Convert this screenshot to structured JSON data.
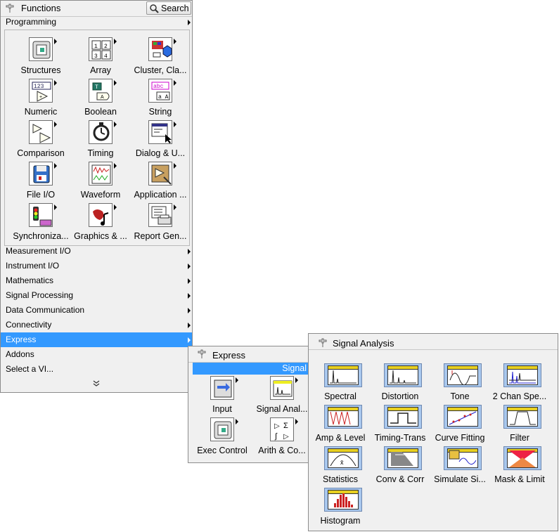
{
  "functions": {
    "title": "Functions",
    "search_label": "Search",
    "programming_label": "Programming",
    "grid": [
      {
        "label": "Structures",
        "icon": "structures-icon"
      },
      {
        "label": "Array",
        "icon": "array-icon"
      },
      {
        "label": "Cluster, Cla...",
        "icon": "cluster-icon"
      },
      {
        "label": "Numeric",
        "icon": "numeric-icon"
      },
      {
        "label": "Boolean",
        "icon": "boolean-icon"
      },
      {
        "label": "String",
        "icon": "string-icon"
      },
      {
        "label": "Comparison",
        "icon": "comparison-icon"
      },
      {
        "label": "Timing",
        "icon": "timing-icon"
      },
      {
        "label": "Dialog & U...",
        "icon": "dialog-icon"
      },
      {
        "label": "File I/O",
        "icon": "file-io-icon"
      },
      {
        "label": "Waveform",
        "icon": "waveform-icon"
      },
      {
        "label": "Application ...",
        "icon": "application-icon"
      },
      {
        "label": "Synchroniza...",
        "icon": "synchronization-icon"
      },
      {
        "label": "Graphics & ...",
        "icon": "graphics-icon"
      },
      {
        "label": "Report Gen...",
        "icon": "report-icon"
      }
    ],
    "categories": [
      {
        "label": "Measurement I/O"
      },
      {
        "label": "Instrument I/O"
      },
      {
        "label": "Mathematics"
      },
      {
        "label": "Signal Processing"
      },
      {
        "label": "Data Communication"
      },
      {
        "label": "Connectivity"
      },
      {
        "label": "Express",
        "selected": true
      },
      {
        "label": "Addons"
      }
    ],
    "select_vi_label": "Select a VI...",
    "more_icon": "double-chevron-down-icon"
  },
  "express": {
    "title": "Express",
    "highlight_label": "Signal",
    "items": [
      {
        "label": "Input",
        "icon": "input-icon"
      },
      {
        "label": "Signal Anal...",
        "icon": "signal-analysis-icon"
      },
      {
        "label": "Exec Control",
        "icon": "exec-control-icon"
      },
      {
        "label": "Arith & Co...",
        "icon": "arith-icon"
      }
    ]
  },
  "signal_analysis": {
    "title": "Signal Analysis",
    "items": [
      {
        "label": "Spectral",
        "icon": "spectral-icon"
      },
      {
        "label": "Distortion",
        "icon": "distortion-icon"
      },
      {
        "label": "Tone",
        "icon": "tone-icon"
      },
      {
        "label": "2 Chan Spe...",
        "icon": "two-channel-spectral-icon"
      },
      {
        "label": "Amp & Level",
        "icon": "amp-level-icon"
      },
      {
        "label": "Timing-Trans",
        "icon": "timing-trans-icon"
      },
      {
        "label": "Curve Fitting",
        "icon": "curve-fitting-icon"
      },
      {
        "label": "Filter",
        "icon": "filter-icon"
      },
      {
        "label": "Statistics",
        "icon": "statistics-icon"
      },
      {
        "label": "Conv & Corr",
        "icon": "conv-corr-icon"
      },
      {
        "label": "Simulate Si...",
        "icon": "simulate-signal-icon"
      },
      {
        "label": "Mask & Limit",
        "icon": "mask-limit-icon"
      },
      {
        "label": "Histogram",
        "icon": "histogram-icon"
      }
    ]
  },
  "colors": {
    "selection": "#3399ff",
    "palette_bg": "#f0f0f0",
    "express_blue": "#a9c8ee"
  }
}
